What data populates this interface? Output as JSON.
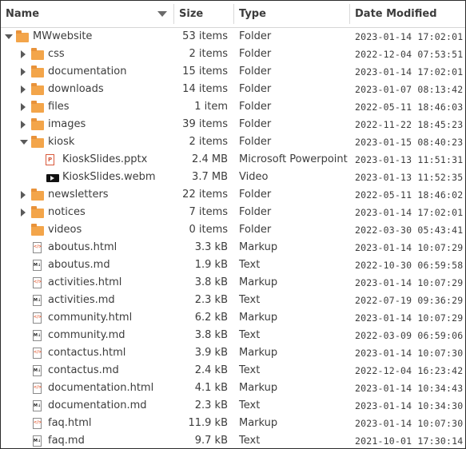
{
  "header": {
    "name": "Name",
    "size": "Size",
    "type": "Type",
    "date": "Date Modified"
  },
  "rows": [
    {
      "name": "MWwebsite",
      "size": "53 items",
      "type": "Folder",
      "date": "2023-01-14 17:02:01",
      "depth": 0,
      "kind": "folder",
      "expander": "down"
    },
    {
      "name": "css",
      "size": "2 items",
      "type": "Folder",
      "date": "2022-12-04 07:53:51",
      "depth": 1,
      "kind": "folder",
      "expander": "right"
    },
    {
      "name": "documentation",
      "size": "15 items",
      "type": "Folder",
      "date": "2023-01-14 17:02:01",
      "depth": 1,
      "kind": "folder",
      "expander": "right"
    },
    {
      "name": "downloads",
      "size": "14 items",
      "type": "Folder",
      "date": "2023-01-07 08:13:42",
      "depth": 1,
      "kind": "folder",
      "expander": "right"
    },
    {
      "name": "files",
      "size": "1 item",
      "type": "Folder",
      "date": "2022-05-11 18:46:03",
      "depth": 1,
      "kind": "folder",
      "expander": "right"
    },
    {
      "name": "images",
      "size": "39 items",
      "type": "Folder",
      "date": "2022-11-22 18:45:23",
      "depth": 1,
      "kind": "folder",
      "expander": "right"
    },
    {
      "name": "kiosk",
      "size": "2 items",
      "type": "Folder",
      "date": "2023-01-15 08:40:23",
      "depth": 1,
      "kind": "folder",
      "expander": "down"
    },
    {
      "name": "KioskSlides.pptx",
      "size": "2.4 MB",
      "type": "Microsoft Powerpoint",
      "date": "2023-01-13 11:51:31",
      "depth": 2,
      "kind": "ppt",
      "expander": "none"
    },
    {
      "name": "KioskSlides.webm",
      "size": "3.7 MB",
      "type": "Video",
      "date": "2023-01-13 11:52:35",
      "depth": 2,
      "kind": "video",
      "expander": "none"
    },
    {
      "name": "newsletters",
      "size": "22 items",
      "type": "Folder",
      "date": "2022-05-11 18:46:02",
      "depth": 1,
      "kind": "folder",
      "expander": "right"
    },
    {
      "name": "notices",
      "size": "7 items",
      "type": "Folder",
      "date": "2023-01-14 17:02:01",
      "depth": 1,
      "kind": "folder",
      "expander": "right"
    },
    {
      "name": "videos",
      "size": "0 items",
      "type": "Folder",
      "date": "2022-03-30 05:43:41",
      "depth": 1,
      "kind": "folder",
      "expander": "none"
    },
    {
      "name": "aboutus.html",
      "size": "3.3 kB",
      "type": "Markup",
      "date": "2023-01-14 10:07:29",
      "depth": 1,
      "kind": "html",
      "expander": "none"
    },
    {
      "name": "aboutus.md",
      "size": "1.9 kB",
      "type": "Text",
      "date": "2022-10-30 06:59:58",
      "depth": 1,
      "kind": "md",
      "expander": "none"
    },
    {
      "name": "activities.html",
      "size": "3.8 kB",
      "type": "Markup",
      "date": "2023-01-14 10:07:29",
      "depth": 1,
      "kind": "html",
      "expander": "none"
    },
    {
      "name": "activities.md",
      "size": "2.3 kB",
      "type": "Text",
      "date": "2022-07-19 09:36:29",
      "depth": 1,
      "kind": "md",
      "expander": "none"
    },
    {
      "name": "community.html",
      "size": "6.2 kB",
      "type": "Markup",
      "date": "2023-01-14 10:07:29",
      "depth": 1,
      "kind": "html",
      "expander": "none"
    },
    {
      "name": "community.md",
      "size": "3.8 kB",
      "type": "Text",
      "date": "2022-03-09 06:59:06",
      "depth": 1,
      "kind": "md",
      "expander": "none"
    },
    {
      "name": "contactus.html",
      "size": "3.9 kB",
      "type": "Markup",
      "date": "2023-01-14 10:07:30",
      "depth": 1,
      "kind": "html",
      "expander": "none"
    },
    {
      "name": "contactus.md",
      "size": "2.4 kB",
      "type": "Text",
      "date": "2022-12-04 16:23:42",
      "depth": 1,
      "kind": "md",
      "expander": "none"
    },
    {
      "name": "documentation.html",
      "size": "4.1 kB",
      "type": "Markup",
      "date": "2023-01-14 10:34:43",
      "depth": 1,
      "kind": "html",
      "expander": "none"
    },
    {
      "name": "documentation.md",
      "size": "2.3 kB",
      "type": "Text",
      "date": "2023-01-14 10:34:30",
      "depth": 1,
      "kind": "md",
      "expander": "none"
    },
    {
      "name": "faq.html",
      "size": "11.9 kB",
      "type": "Markup",
      "date": "2023-01-14 10:07:30",
      "depth": 1,
      "kind": "html",
      "expander": "none"
    },
    {
      "name": "faq.md",
      "size": "9.7 kB",
      "type": "Text",
      "date": "2021-10-01 17:30:14",
      "depth": 1,
      "kind": "md",
      "expander": "none"
    }
  ]
}
